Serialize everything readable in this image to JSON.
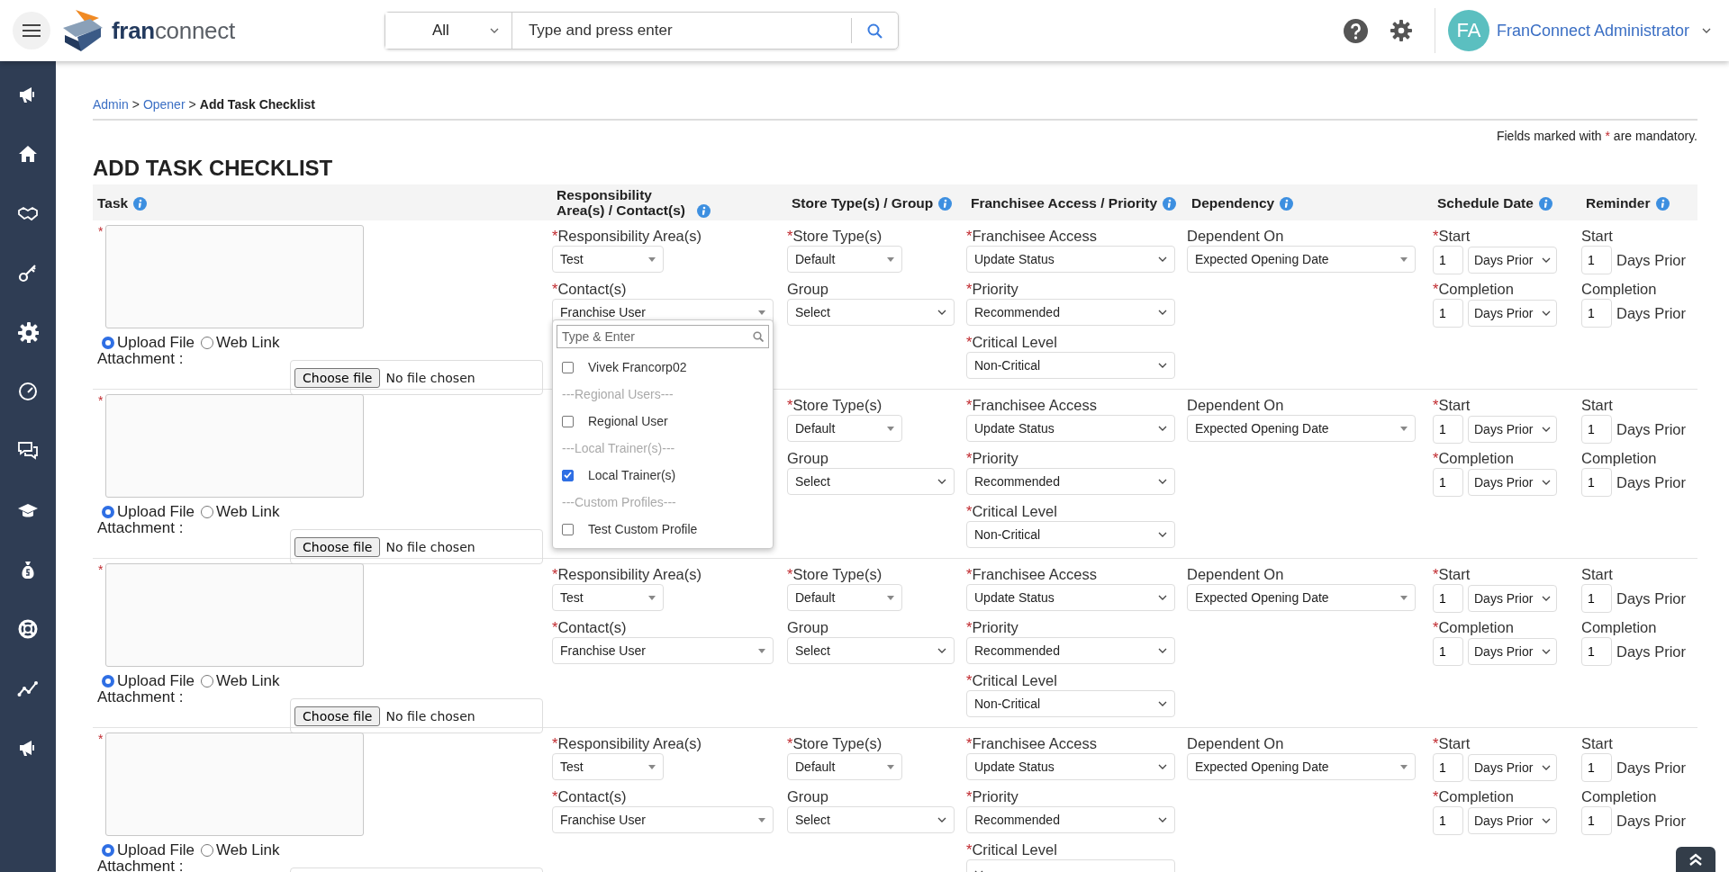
{
  "header": {
    "logo_text": [
      "fran",
      "connect"
    ],
    "search": {
      "scope": "All",
      "placeholder": "Type and press enter"
    },
    "user": {
      "initials": "FA",
      "name": "FranConnect Administrator"
    }
  },
  "breadcrumb": [
    {
      "label": "Admin",
      "kind": "link"
    },
    {
      "label": ">",
      "kind": "separator"
    },
    {
      "label": "Opener",
      "kind": "link"
    },
    {
      "label": ">",
      "kind": "separator"
    },
    {
      "label": "Add Task Checklist",
      "kind": "current"
    }
  ],
  "mandatory_note": {
    "before": "Fields marked with",
    "mark": "*",
    "after": "are mandatory."
  },
  "title": "ADD TASK CHECKLIST",
  "table": {
    "columns": [
      {
        "label": "Task",
        "info": true
      },
      {
        "label": "Responsibility Area(s) / Contact(s)",
        "info": true
      },
      {
        "label": "Store Type(s) / Group",
        "info": true
      },
      {
        "label": "Franchisee Access / Priority",
        "info": true
      },
      {
        "label": "Dependency",
        "info": true
      },
      {
        "label": "Schedule Date",
        "info": true
      },
      {
        "label": "Reminder",
        "info": true
      }
    ],
    "rows": [
      {
        "task": {
          "mark": "*",
          "attachment_types": [
            {
              "label": "Upload File",
              "selected": true
            },
            {
              "label": "Web Link",
              "selected": false
            }
          ],
          "attachment_label": "Attachment :",
          "file_button": "Choose file",
          "file_status": "No file chosen"
        },
        "responsibility": [
          {
            "kind": "combo",
            "mark": "*",
            "label": "Responsibility Area(s)",
            "value": "Test"
          },
          {
            "kind": "combo",
            "mark": "*",
            "label": "Contact(s)",
            "value": "Franchise User",
            "expanded": true,
            "menu": {
              "placeholder": "Type & Enter",
              "options": [
                {
                  "kind": "option",
                  "label": "Vivek Francorp02",
                  "checked": false
                },
                {
                  "kind": "group",
                  "label": "---Regional Users---"
                },
                {
                  "kind": "option",
                  "label": "Regional User",
                  "checked": false
                },
                {
                  "kind": "group",
                  "label": "---Local Trainer(s)---"
                },
                {
                  "kind": "option",
                  "label": "Local Trainer(s)",
                  "checked": true
                },
                {
                  "kind": "group",
                  "label": "---Custom Profiles---"
                },
                {
                  "kind": "option",
                  "label": "Test Custom Profile",
                  "checked": false
                }
              ]
            }
          }
        ],
        "store": [
          {
            "kind": "combo",
            "mark": "*",
            "label": "Store Type(s)",
            "value": "Default"
          },
          {
            "kind": "select",
            "label": "Group",
            "value": "Select"
          }
        ],
        "access": [
          {
            "kind": "select",
            "mark": "*",
            "label": "Franchisee Access",
            "value": "Update Status"
          },
          {
            "kind": "select",
            "mark": "*",
            "label": "Priority",
            "value": "Recommended"
          },
          {
            "kind": "select",
            "mark": "*",
            "label": "Critical Level",
            "value": "Non-Critical"
          }
        ],
        "dependency": [
          {
            "kind": "combo",
            "label": "Dependent On",
            "value": "Expected Opening Date"
          }
        ],
        "schedule": [
          {
            "kind": "number_select",
            "mark": "*",
            "label": "Start",
            "number": "1",
            "value": "Days Prior"
          },
          {
            "kind": "number_select",
            "mark": "*",
            "label": "Completion",
            "number": "1",
            "value": "Days Prior"
          }
        ],
        "reminder": [
          {
            "kind": "number_text",
            "label": "Start",
            "number": "1",
            "unit": "Days Prior"
          },
          {
            "kind": "number_text",
            "label": "Completion",
            "number": "1",
            "unit": "Days Prior"
          }
        ]
      },
      {
        "task": {
          "mark": "*",
          "attachment_types": [
            {
              "label": "Upload File",
              "selected": true
            },
            {
              "label": "Web Link",
              "selected": false
            }
          ],
          "attachment_label": "Attachment :",
          "file_button": "Choose file",
          "file_status": "No file chosen"
        },
        "store": [
          {
            "kind": "combo",
            "mark": "*",
            "label": "Store Type(s)",
            "value": "Default"
          },
          {
            "kind": "select",
            "label": "Group",
            "value": "Select"
          }
        ],
        "access": [
          {
            "kind": "select",
            "mark": "*",
            "label": "Franchisee Access",
            "value": "Update Status"
          },
          {
            "kind": "select",
            "mark": "*",
            "label": "Priority",
            "value": "Recommended"
          },
          {
            "kind": "select",
            "mark": "*",
            "label": "Critical Level",
            "value": "Non-Critical"
          }
        ],
        "dependency": [
          {
            "kind": "combo",
            "label": "Dependent On",
            "value": "Expected Opening Date"
          }
        ],
        "schedule": [
          {
            "kind": "number_select",
            "mark": "*",
            "label": "Start",
            "number": "1",
            "value": "Days Prior"
          },
          {
            "kind": "number_select",
            "mark": "*",
            "label": "Completion",
            "number": "1",
            "value": "Days Prior"
          }
        ],
        "reminder": [
          {
            "kind": "number_text",
            "label": "Start",
            "number": "1",
            "unit": "Days Prior"
          },
          {
            "kind": "number_text",
            "label": "Completion",
            "number": "1",
            "unit": "Days Prior"
          }
        ]
      },
      {
        "task": {
          "mark": "*",
          "attachment_types": [
            {
              "label": "Upload File",
              "selected": true
            },
            {
              "label": "Web Link",
              "selected": false
            }
          ],
          "attachment_label": "Attachment :",
          "file_button": "Choose file",
          "file_status": "No file chosen"
        },
        "responsibility": [
          {
            "kind": "combo",
            "mark": "*",
            "label": "Responsibility Area(s)",
            "value": "Test"
          },
          {
            "kind": "combo",
            "mark": "*",
            "label": "Contact(s)",
            "value": "Franchise User"
          }
        ],
        "store": [
          {
            "kind": "combo",
            "mark": "*",
            "label": "Store Type(s)",
            "value": "Default"
          },
          {
            "kind": "select",
            "label": "Group",
            "value": "Select"
          }
        ],
        "access": [
          {
            "kind": "select",
            "mark": "*",
            "label": "Franchisee Access",
            "value": "Update Status"
          },
          {
            "kind": "select",
            "mark": "*",
            "label": "Priority",
            "value": "Recommended"
          },
          {
            "kind": "select",
            "mark": "*",
            "label": "Critical Level",
            "value": "Non-Critical"
          }
        ],
        "dependency": [
          {
            "kind": "combo",
            "label": "Dependent On",
            "value": "Expected Opening Date"
          }
        ],
        "schedule": [
          {
            "kind": "number_select",
            "mark": "*",
            "label": "Start",
            "number": "1",
            "value": "Days Prior"
          },
          {
            "kind": "number_select",
            "mark": "*",
            "label": "Completion",
            "number": "1",
            "value": "Days Prior"
          }
        ],
        "reminder": [
          {
            "kind": "number_text",
            "label": "Start",
            "number": "1",
            "unit": "Days Prior"
          },
          {
            "kind": "number_text",
            "label": "Completion",
            "number": "1",
            "unit": "Days Prior"
          }
        ]
      },
      {
        "task": {
          "mark": "*",
          "attachment_types": [
            {
              "label": "Upload File",
              "selected": true
            },
            {
              "label": "Web Link",
              "selected": false
            }
          ],
          "attachment_label": "Attachment :"
        },
        "responsibility": [
          {
            "kind": "combo",
            "mark": "*",
            "label": "Responsibility Area(s)",
            "value": "Test"
          },
          {
            "kind": "combo",
            "mark": "*",
            "label": "Contact(s)",
            "value": "Franchise User"
          }
        ],
        "store": [
          {
            "kind": "combo",
            "mark": "*",
            "label": "Store Type(s)",
            "value": "Default"
          },
          {
            "kind": "select",
            "label": "Group",
            "value": "Select"
          }
        ],
        "access": [
          {
            "kind": "select",
            "mark": "*",
            "label": "Franchisee Access",
            "value": "Update Status"
          },
          {
            "kind": "select",
            "mark": "*",
            "label": "Priority",
            "value": "Recommended"
          },
          {
            "kind": "select",
            "mark": "*",
            "label": "Critical Level"
          }
        ],
        "dependency": [
          {
            "kind": "combo",
            "label": "Dependent On",
            "value": "Expected Opening Date"
          }
        ],
        "schedule": [
          {
            "kind": "number_select",
            "mark": "*",
            "label": "Start",
            "number": "1",
            "value": "Days Prior"
          },
          {
            "kind": "number_select",
            "mark": "*",
            "label": "Completion",
            "number": "1",
            "value": "Days Prior"
          }
        ],
        "reminder": [
          {
            "kind": "number_text",
            "label": "Start",
            "number": "1",
            "unit": "Days Prior"
          },
          {
            "kind": "number_text",
            "label": "Completion",
            "number": "1",
            "unit": "Days Prior"
          }
        ]
      }
    ]
  }
}
